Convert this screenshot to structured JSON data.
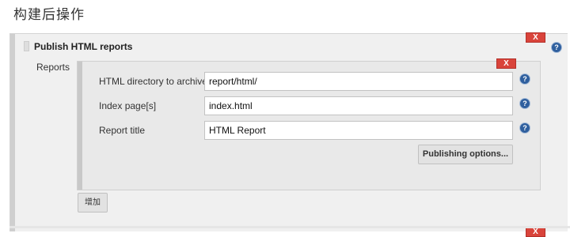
{
  "section": {
    "title": "构建后操作"
  },
  "publisher": {
    "title": "Publish HTML reports",
    "delete_label": "X",
    "help_symbol": "?"
  },
  "reports": {
    "label": "Reports",
    "delete_label": "X",
    "fields": [
      {
        "label": "HTML directory to archive",
        "value": "report/html/"
      },
      {
        "label": "Index page[s]",
        "value": "index.html"
      },
      {
        "label": "Report title",
        "value": "HTML Report"
      }
    ],
    "publishing_options_label": "Publishing options..."
  },
  "add_button_label": "增加",
  "next_block": {
    "delete_label": "X"
  },
  "colors": {
    "delete_red": "#d9443b",
    "help_blue": "#2f5f9e",
    "panel_gray": "#f0f0f0"
  }
}
